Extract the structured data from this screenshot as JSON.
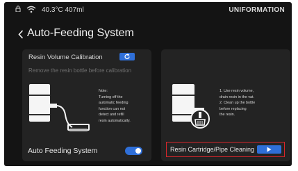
{
  "status_bar": {
    "temperature_volume": "40.3°C 407ml",
    "brand": "UNIFORMATION",
    "icons": [
      "lock-icon",
      "wifi-icon"
    ]
  },
  "header": {
    "title": "Auto-Feeding System",
    "back_icon": "chevron-left-icon"
  },
  "left_panel": {
    "calibration_label": "Resin Volume Calibration",
    "calibration_button_icon": "refresh-icon",
    "calibration_hint": "Remove the resin bottle before calibration",
    "note_lines": [
      "Note:",
      "Turning off the",
      "automatic feeding",
      "function can not",
      "detect and refill",
      "resin automatically."
    ],
    "auto_feeding_label": "Auto Feeding System",
    "auto_feeding_enabled": true
  },
  "right_panel": {
    "instruction_lines": [
      "1. Use resin volume,",
      "drain resin in the vat.",
      "2. Clean up the bottle",
      "before replacing",
      "the resin."
    ],
    "cleaning_label": "Resin Cartridge/Pipe Cleaning",
    "cleaning_button_icon": "play-icon"
  },
  "colors": {
    "accent": "#2f6fd8",
    "highlight_border": "#d8262b",
    "panel_background": "#232323",
    "screen_background": "#141414"
  }
}
